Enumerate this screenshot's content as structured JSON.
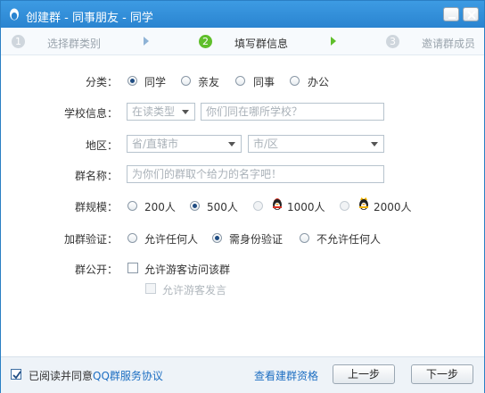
{
  "window": {
    "title": "创建群 - 同事朋友 - 同学"
  },
  "steps": [
    {
      "num": "1",
      "label": "选择群类别",
      "active": false
    },
    {
      "num": "2",
      "label": "填写群信息",
      "active": true
    },
    {
      "num": "3",
      "label": "邀请群成员",
      "active": false
    }
  ],
  "form": {
    "category": {
      "label": "分类：",
      "options": [
        "同学",
        "亲友",
        "同事",
        "办公"
      ],
      "selected": "同学"
    },
    "school": {
      "label": "学校信息：",
      "type_placeholder": "在读类型",
      "name_placeholder": "你们同在哪所学校？"
    },
    "region": {
      "label": "地区：",
      "province_placeholder": "省/直辖市",
      "city_placeholder": "市/区"
    },
    "group_name": {
      "label": "群名称：",
      "placeholder": "为你们的群取个给力的名字吧！"
    },
    "scale": {
      "label": "群规模：",
      "options": [
        "200人",
        "500人",
        "1000人",
        "2000人"
      ],
      "selected": "500人"
    },
    "verify": {
      "label": "加群验证：",
      "options": [
        "允许任何人",
        "需身份验证",
        "不允许任何人"
      ],
      "selected": "需身份验证"
    },
    "public": {
      "label": "群公开：",
      "allow_guest_visit": "允许游客访问该群",
      "allow_guest_speak": "允许游客发言"
    }
  },
  "footer": {
    "agree_prefix": "已阅读并同意",
    "agree_link": "QQ群服务协议",
    "qualification_link": "查看建群资格",
    "prev_button": "上一步",
    "next_button": "下一步"
  },
  "colors": {
    "titlebar": "#2a84d0",
    "active_step": "#5fbf2b",
    "link": "#1e6fc2"
  }
}
